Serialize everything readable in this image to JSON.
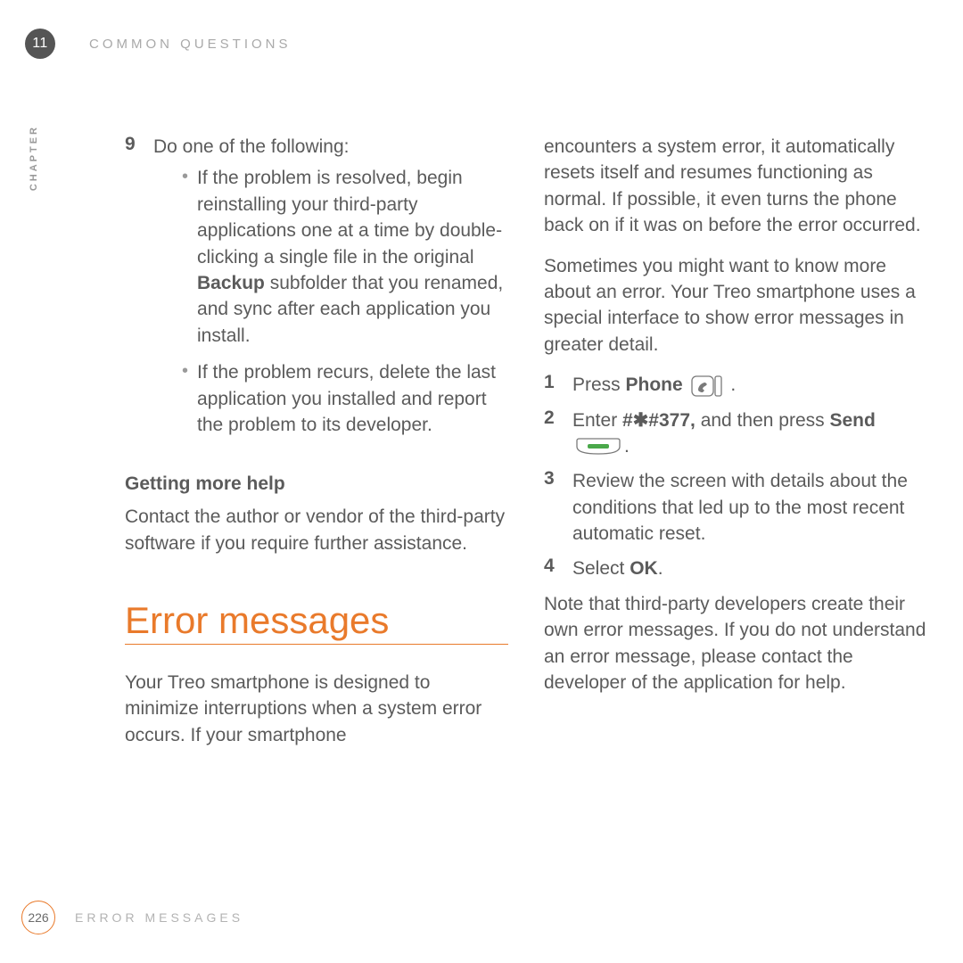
{
  "header": {
    "chapter_number": "11",
    "section_label": "COMMON QUESTIONS",
    "vertical_label": "CHAPTER"
  },
  "left_column": {
    "step9_num": "9",
    "step9_text": "Do one of the following:",
    "bullet1_a": "If the problem is resolved, begin reinstalling your third-party applications one at a time by double-clicking a single file in the original ",
    "bullet1_bold": "Backup",
    "bullet1_b": " subfolder that you renamed, and sync after each application you install.",
    "bullet2": "If the problem recurs, delete the last application you installed and report the problem to its developer.",
    "subheading": "Getting more help",
    "subtext": "Contact the author or vendor of the third-party software if you require further assistance.",
    "section_heading": "Error messages",
    "section_intro": "Your Treo smartphone is designed to minimize interruptions when a system error occurs. If your smartphone"
  },
  "right_column": {
    "continuation": "encounters a system error, it automatically resets itself and resumes functioning as normal. If possible, it even turns the phone back on if it was on before the error occurred.",
    "para2": "Sometimes you might want to know more about an error. Your Treo smartphone uses a special interface to show error messages in greater detail.",
    "step1_num": "1",
    "step1_a": "Press ",
    "step1_bold": "Phone",
    "step1_b": " .",
    "step2_num": "2",
    "step2_a": "Enter ",
    "step2_bold": "#✱#377,",
    "step2_b": " and then press ",
    "step2_bold2": "Send",
    "step2_c": ".",
    "step3_num": "3",
    "step3_text": "Review the screen with details about the conditions that led up to the most recent automatic reset.",
    "step4_num": "4",
    "step4_a": "Select ",
    "step4_bold": "OK",
    "step4_b": ".",
    "note": "Note that third-party developers create their own error messages. If you do not understand an error message, please contact the developer of the application for help."
  },
  "footer": {
    "page_number": "226",
    "footer_label": "ERROR MESSAGES"
  },
  "icons": {
    "phone_key": "phone-key-icon",
    "send_key": "send-key-icon"
  }
}
